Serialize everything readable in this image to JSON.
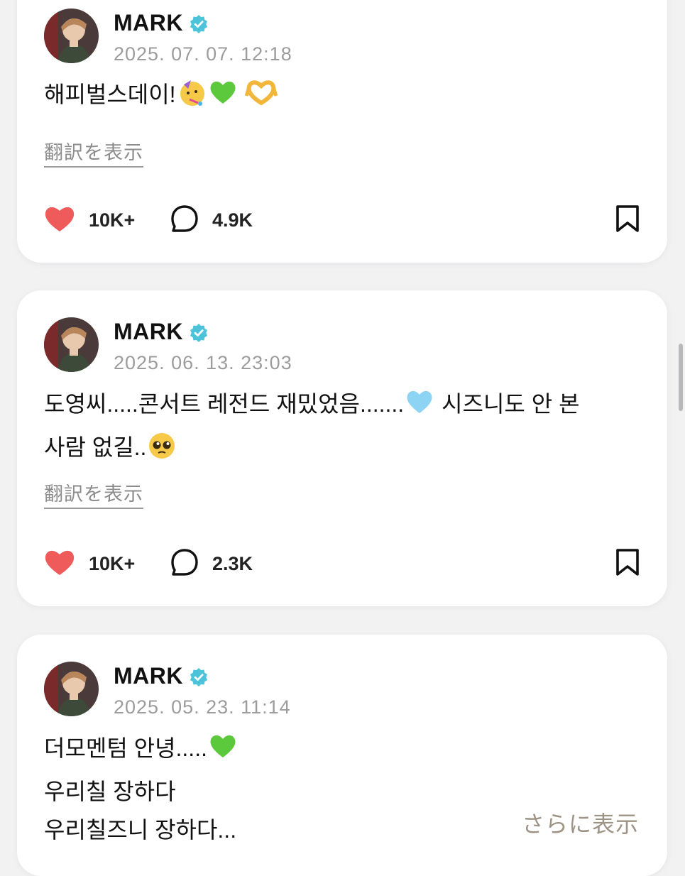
{
  "posts": [
    {
      "author": "MARK",
      "verified_icon": "verified-badge-icon",
      "date": "2025. 07. 07. 12:18",
      "text_lines": [
        {
          "text": "해피벌스데이!",
          "emojis": [
            "partying-face",
            "green-heart",
            "heart-hands"
          ]
        }
      ],
      "translate_label": "翻訳を表示",
      "likes": "10K+",
      "comments": "4.9K"
    },
    {
      "author": "MARK",
      "verified_icon": "verified-badge-icon",
      "date": "2025. 06. 13. 23:03",
      "text_lines": [
        {
          "text": "도영씨.....콘서트 레전드 재밌었음.......",
          "emojis": [
            "light-blue-heart"
          ],
          "after": " 시즈니도 안 본"
        },
        {
          "text": "사람 없길..",
          "emojis": [
            "pleading-face"
          ]
        }
      ],
      "translate_label": "翻訳を表示",
      "likes": "10K+",
      "comments": "2.3K"
    },
    {
      "author": "MARK",
      "verified_icon": "verified-badge-icon",
      "date": "2025. 05. 23. 11:14",
      "text_lines": [
        {
          "text": "더모멘텀 안녕.....",
          "emojis": [
            "green-heart"
          ]
        },
        {
          "text": "우리칠 장하다",
          "emojis": []
        },
        {
          "text": "우리칠즈니 장하다...",
          "emojis": []
        }
      ],
      "more_label": "さらに表示"
    }
  ],
  "colors": {
    "background": "#f2f2f3",
    "card": "#ffffff",
    "like_heart": "#ef5a5a",
    "verified": "#4cc3d9",
    "date": "#9c9c9c",
    "more": "#9e9486"
  }
}
